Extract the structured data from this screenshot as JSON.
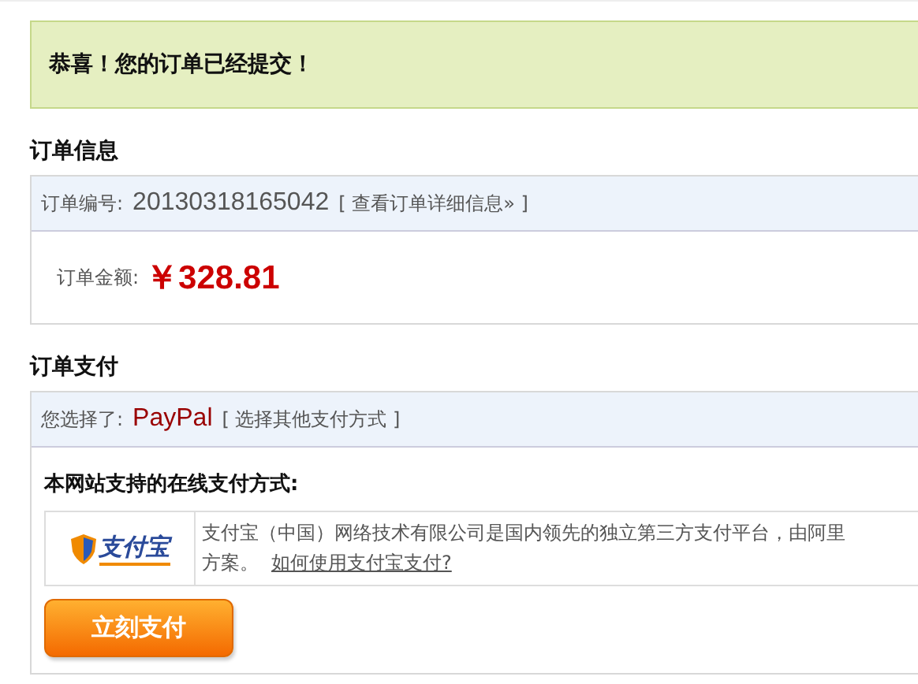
{
  "success_message": "恭喜！您的订单已经提交！",
  "order_info": {
    "heading": "订单信息",
    "number_label": "订单编号:",
    "number": "20130318165042",
    "details_link": "[ 查看订单详细信息» ]",
    "amount_label": "订单金额:",
    "amount": "￥328.81"
  },
  "payment": {
    "heading": "订单支付",
    "chosen_label": "您选择了:",
    "chosen_method": "PayPal",
    "change_link": "[ 选择其他支付方式 ]",
    "methods_heading": "本网站支持的在线支付方式:",
    "methods": [
      {
        "logo_text": "支付宝",
        "description": [
          "支付宝（中国）网络技术有限公司是国内领先的独立第三方支付平台，由阿里",
          "方案。"
        ],
        "help_link": "如何使用支付宝支付?"
      }
    ],
    "pay_button": "立刻支付"
  }
}
